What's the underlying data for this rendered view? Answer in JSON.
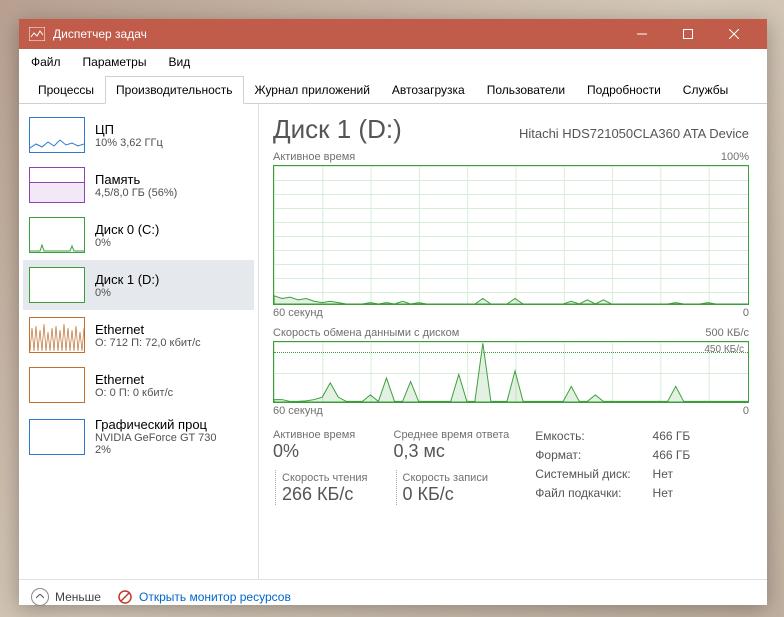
{
  "titlebar": {
    "title": "Диспетчер задач"
  },
  "menu": {
    "file": "Файл",
    "options": "Параметры",
    "view": "Вид"
  },
  "tabs": {
    "processes": "Процессы",
    "performance": "Производительность",
    "app_history": "Журнал приложений",
    "startup": "Автозагрузка",
    "users": "Пользователи",
    "details": "Подробности",
    "services": "Службы"
  },
  "sidebar": [
    {
      "title": "ЦП",
      "sub": "10%  3,62 ГГц",
      "color": "#2e78d0"
    },
    {
      "title": "Память",
      "sub": "4,5/8,0 ГБ (56%)",
      "color": "#8e44ad"
    },
    {
      "title": "Диск 0 (C:)",
      "sub": "0%",
      "color": "#3b9e3b"
    },
    {
      "title": "Диск 1 (D:)",
      "sub": "0%",
      "color": "#3b9e3b"
    },
    {
      "title": "Ethernet",
      "sub": "О: 712  П: 72,0 кбит/с",
      "color": "#c07030"
    },
    {
      "title": "Ethernet",
      "sub": "О: 0  П: 0 кбит/с",
      "color": "#c07030"
    },
    {
      "title": "Графический проц",
      "sub": "NVIDIA GeForce GT 730",
      "sub2": "2%",
      "color": "#2e78d0"
    }
  ],
  "main": {
    "title": "Диск 1 (D:)",
    "device": "Hitachi HDS721050CLA360 ATA Device",
    "chart1_label": "Активное время",
    "chart1_max": "100%",
    "axis_left": "60 секунд",
    "axis_right": "0",
    "chart2_label": "Скорость обмена данными с диском",
    "chart2_max": "500 КБ/с",
    "chart2_dash": "450 КБ/с",
    "stats": {
      "active_lbl": "Активное время",
      "active_val": "0%",
      "avg_lbl": "Среднее время ответа",
      "avg_val": "0,3 мс",
      "read_lbl": "Скорость чтения",
      "read_val": "266 КБ/с",
      "write_lbl": "Скорость записи",
      "write_val": "0 КБ/с"
    },
    "props_labels": {
      "cap": "Емкость:",
      "fmt": "Формат:",
      "sys": "Системный диск:",
      "pf": "Файл подкачки:"
    },
    "props_vals": {
      "cap": "466 ГБ",
      "fmt": "466 ГБ",
      "sys": "Нет",
      "pf": "Нет"
    }
  },
  "footer": {
    "less": "Меньше",
    "resmon": "Открыть монитор ресурсов"
  },
  "chart_data": [
    {
      "type": "area",
      "title": "Активное время",
      "ylabel": "%",
      "ylim": [
        0,
        100
      ],
      "xlabel": "секунд",
      "xlim": [
        60,
        0
      ],
      "values": [
        6,
        4,
        5,
        3,
        4,
        2,
        1,
        2,
        1,
        0,
        0,
        0,
        1,
        0,
        1,
        0,
        2,
        0,
        1,
        0,
        0,
        0,
        0,
        0,
        0,
        0,
        4,
        0,
        0,
        0,
        4,
        0,
        0,
        0,
        0,
        0,
        0,
        2,
        0,
        3,
        0,
        3,
        0,
        0,
        0,
        0,
        0,
        0,
        0,
        0,
        1,
        0,
        0,
        0,
        1,
        0,
        0,
        0,
        0,
        0
      ]
    },
    {
      "type": "area",
      "title": "Скорость обмена данными с диском",
      "ylabel": "КБ/с",
      "ylim": [
        0,
        500
      ],
      "xlabel": "секунд",
      "xlim": [
        60,
        0
      ],
      "annotations": [
        "450 КБ/с"
      ],
      "values": [
        20,
        20,
        5,
        5,
        10,
        20,
        40,
        160,
        40,
        5,
        5,
        5,
        60,
        5,
        200,
        5,
        5,
        170,
        5,
        5,
        5,
        5,
        5,
        230,
        5,
        5,
        490,
        5,
        5,
        5,
        260,
        5,
        5,
        5,
        5,
        5,
        5,
        130,
        5,
        5,
        60,
        5,
        5,
        5,
        5,
        5,
        5,
        5,
        5,
        5,
        130,
        5,
        5,
        5,
        5,
        5,
        5,
        5,
        5,
        5
      ]
    }
  ]
}
